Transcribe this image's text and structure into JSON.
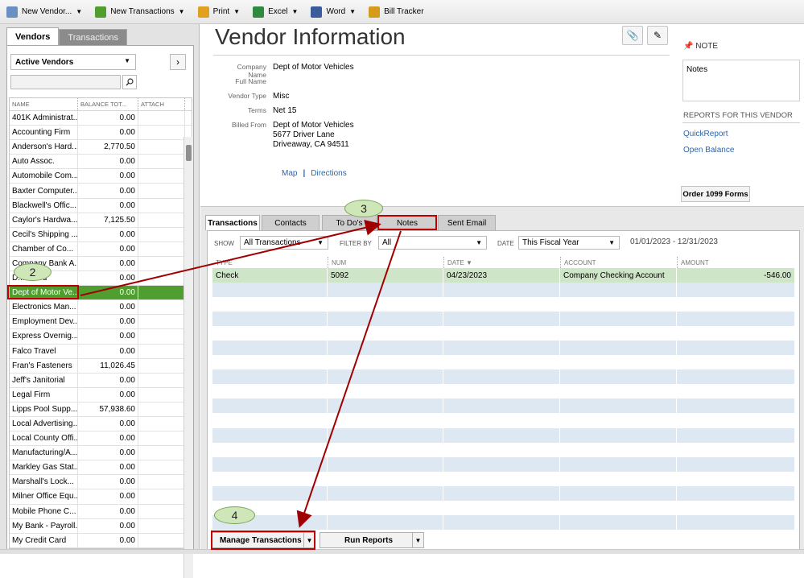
{
  "toolbar": {
    "items": [
      {
        "label": "New Vendor...",
        "icon": "vendor-icon",
        "color": "#6a8fc2"
      },
      {
        "label": "New Transactions",
        "icon": "transactions-icon",
        "color": "#4f9e2f"
      },
      {
        "label": "Print",
        "icon": "print-icon",
        "color": "#e0a020"
      },
      {
        "label": "Excel",
        "icon": "excel-icon",
        "color": "#2f8a3f"
      },
      {
        "label": "Word",
        "icon": "word-icon",
        "color": "#3a5c9a"
      },
      {
        "label": "Bill Tracker",
        "icon": "bill-tracker-icon",
        "color": "#d59b1a"
      }
    ]
  },
  "sidebar": {
    "tab_vendors": "Vendors",
    "tab_transactions": "Transactions",
    "filter": "Active Vendors",
    "columns": {
      "name": "NAME",
      "balance": "BALANCE TOT...",
      "attach": "ATTACH"
    },
    "vendors": [
      {
        "name": "401K Administrat...",
        "balance": "0.00"
      },
      {
        "name": "Accounting Firm",
        "balance": "0.00"
      },
      {
        "name": "Anderson's Hard...",
        "balance": "2,770.50"
      },
      {
        "name": "Auto Assoc.",
        "balance": "0.00"
      },
      {
        "name": "Automobile Com...",
        "balance": "0.00"
      },
      {
        "name": "Baxter Computer...",
        "balance": "0.00"
      },
      {
        "name": "Blackwell's Offic...",
        "balance": "0.00"
      },
      {
        "name": "Caylor's Hardwa...",
        "balance": "7,125.50"
      },
      {
        "name": "Cecil's Shipping ...",
        "balance": "0.00"
      },
      {
        "name": "Chamber of Co...",
        "balance": "0.00"
      },
      {
        "name": "Company Bank A...",
        "balance": "0.00"
      },
      {
        "name": "D... ...ood",
        "balance": "0.00"
      },
      {
        "name": "Dept of Motor Ve...",
        "balance": "0.00",
        "selected": true
      },
      {
        "name": "Electronics Man...",
        "balance": "0.00"
      },
      {
        "name": "Employment Dev...",
        "balance": "0.00"
      },
      {
        "name": "Express Overnig...",
        "balance": "0.00"
      },
      {
        "name": "Falco Travel",
        "balance": "0.00"
      },
      {
        "name": "Fran's Fasteners",
        "balance": "11,026.45"
      },
      {
        "name": "Jeff's Janitorial",
        "balance": "0.00"
      },
      {
        "name": "Legal Firm",
        "balance": "0.00"
      },
      {
        "name": "Lipps Pool Supp...",
        "balance": "57,938.60"
      },
      {
        "name": "Local Advertising...",
        "balance": "0.00"
      },
      {
        "name": "Local County Offi...",
        "balance": "0.00"
      },
      {
        "name": "Manufacturing/A...",
        "balance": "0.00"
      },
      {
        "name": "Markley Gas Stat...",
        "balance": "0.00"
      },
      {
        "name": "Marshall's Lock...",
        "balance": "0.00"
      },
      {
        "name": "Milner Office Equ...",
        "balance": "0.00"
      },
      {
        "name": "Mobile Phone C...",
        "balance": "0.00"
      },
      {
        "name": "My Bank - Payroll...",
        "balance": "0.00"
      },
      {
        "name": "My Credit Card",
        "balance": "0.00"
      }
    ]
  },
  "vendor": {
    "title": "Vendor Information",
    "labels": {
      "company": "Company Name",
      "full_name": "Full Name",
      "type": "Vendor Type",
      "terms": "Terms",
      "billed": "Billed From"
    },
    "company": "Dept of Motor Vehicles",
    "full_name": "",
    "type": "Misc",
    "terms": "Net 15",
    "billed_line1": "Dept of Motor Vehicles",
    "billed_line2": "5677 Driver Lane",
    "billed_line3": "Driveaway, CA 94511",
    "map": "Map",
    "directions": "Directions"
  },
  "side": {
    "note_title": "NOTE",
    "notes": "Notes",
    "reports_title": "REPORTS FOR THIS VENDOR",
    "quickreport": "QuickReport",
    "open_balance": "Open Balance",
    "order_1099": "Order 1099 Forms"
  },
  "tabs": [
    "Transactions",
    "Contacts",
    "To Do's",
    "Notes",
    "Sent Email"
  ],
  "filters": {
    "show_label": "SHOW",
    "show": "All Transactions",
    "filter_label": "FILTER BY",
    "filter": "All",
    "date_label": "DATE",
    "date": "This Fiscal Year",
    "range": "01/01/2023 - 12/31/2023"
  },
  "tx": {
    "columns": [
      "TYPE",
      "NUM",
      "DATE ▼",
      "ACCOUNT",
      "AMOUNT"
    ],
    "rows": [
      {
        "type": "Check",
        "num": "5092",
        "date": "04/23/2023",
        "account": "Company Checking Account",
        "amount": "-546.00"
      }
    ]
  },
  "buttons": {
    "manage": "Manage Transactions",
    "run": "Run Reports"
  },
  "callouts": {
    "c2": "2",
    "c3": "3",
    "c4": "4"
  }
}
